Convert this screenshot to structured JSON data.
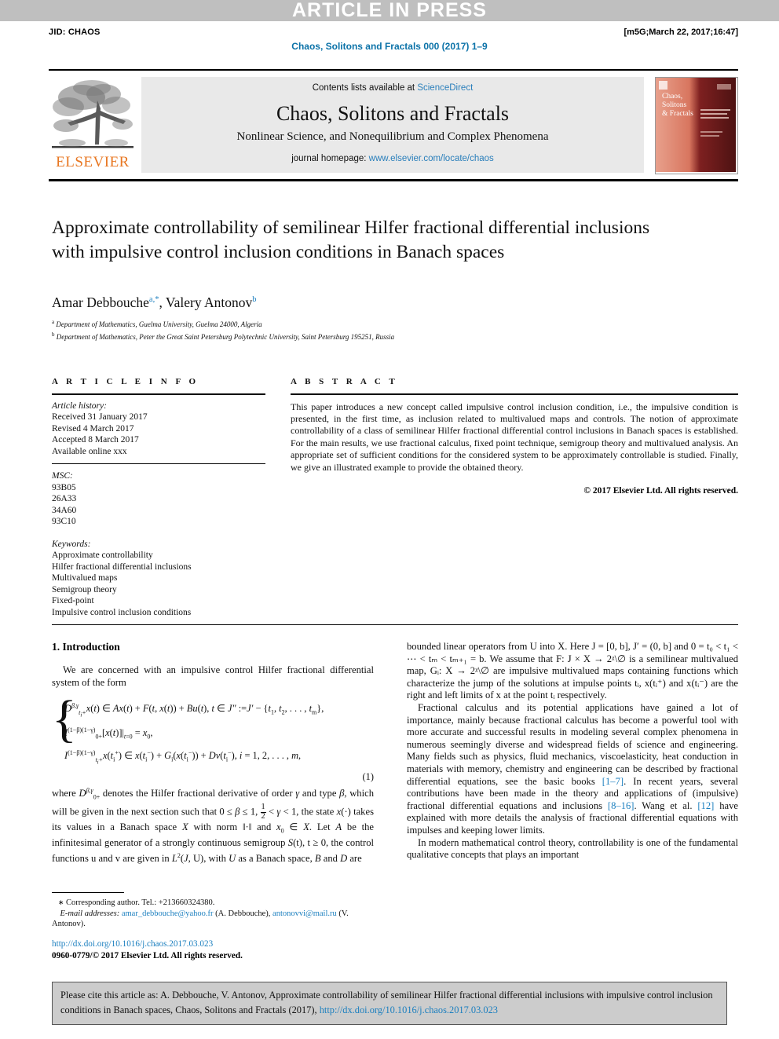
{
  "banner": {
    "text": "ARTICLE IN PRESS"
  },
  "runhead": {
    "jid": "JID: CHAOS",
    "stamp": "[m5G;March 22, 2017;16:47]",
    "journal_ref": "Chaos, Solitons and Fractals 000 (2017) 1–9"
  },
  "masthead": {
    "publisher": "ELSEVIER",
    "contents_prefix": "Contents lists available at ",
    "contents_link": "ScienceDirect",
    "journal_name": "Chaos, Solitons and Fractals",
    "journal_subtitle": "Nonlinear Science, and Nonequilibrium and Complex Phenomena",
    "homepage_prefix": "journal homepage: ",
    "homepage_link": "www.elsevier.com/locate/chaos",
    "cover_title_line1": "Chaos,",
    "cover_title_line2": "Solitons",
    "cover_title_line3": "& Fractals"
  },
  "article": {
    "title": "Approximate controllability of semilinear Hilfer fractional differential inclusions with impulsive control inclusion conditions in Banach spaces",
    "author1": "Amar Debbouche",
    "author1_sup": "a,*",
    "author2": "Valery Antonov",
    "author2_sup": "b",
    "affiliation_a": "Department of Mathematics, Guelma University, Guelma 24000, Algeria",
    "affiliation_b": "Department of Mathematics, Peter the Great Saint Petersburg Polytechnic University, Saint Petersburg 195251, Russia"
  },
  "info": {
    "heading": "A R T I C L E    I N F O",
    "history_label": "Article history:",
    "history": [
      "Received 31 January 2017",
      "Revised 4 March 2017",
      "Accepted 8 March 2017",
      "Available online xxx"
    ],
    "msc_label": "MSC:",
    "msc": [
      "93B05",
      "26A33",
      "34A60",
      "93C10"
    ],
    "keywords_label": "Keywords:",
    "keywords": [
      "Approximate controllability",
      "Hilfer fractional differential inclusions",
      "Multivalued maps",
      "Semigroup theory",
      "Fixed-point",
      "Impulsive control inclusion conditions"
    ]
  },
  "abstract": {
    "heading": "A B S T R A C T",
    "text": "This paper introduces a new concept called impulsive control inclusion condition, i.e., the impulsive condition is presented, in the first time, as inclusion related to multivalued maps and controls. The notion of approximate controllability of a class of semilinear Hilfer fractional differential control inclusions in Banach spaces is established. For the main results, we use fractional calculus, fixed point technique, semigroup theory and multivalued analysis. An appropriate set of sufficient conditions for the considered system to be approximately controllable is studied. Finally, we give an illustrated example to provide the obtained theory.",
    "copyright": "© 2017 Elsevier Ltd. All rights reserved."
  },
  "body": {
    "section_title": "1. Introduction",
    "left_p1": "We are concerned with an impulsive control Hilfer fractional differential system of the form",
    "eq_number": "(1)",
    "left_p2_a": "where ",
    "left_p2_b": " denotes the Hilfer fractional derivative of order ",
    "left_p2_c": " and type ",
    "left_p2_d": ", which will be given in the next section such that 0 ≤ ",
    "left_p2_e": " ≤ 1, ",
    "left_p2_f": " < ",
    "left_p2_g": " < 1, the state ",
    "left_p2_h": "(·) takes its values in a Banach space ",
    "left_p2_i": " with norm ‖·‖ and ",
    "left_p2_j": " ∈ ",
    "left_p2_k": ". Let ",
    "left_p2_l": " be the infinitesimal generator of a strongly continuous semigroup ",
    "left_p2_m": "(t), t ≥ 0, the control functions u and v are given in ",
    "left_p2_n": ", U), with ",
    "left_p2_o": " as a Banach space, ",
    "left_p2_p": " and ",
    "left_p2_q": " are",
    "right_p1": "bounded linear operators from U into X. Here J = [0, b], J′ = (0, b] and 0 = t₀ < t₁ < ⋯ < tₘ < tₘ₊₁ = b. We assume that F: J × X → 2ᵡ\\∅ is a semilinear multivalued map, Gᵢ: X → 2ᵡ\\∅ are impulsive multivalued maps containing functions which characterize the jump of the solutions at impulse points tᵢ, x(tᵢ⁺) and x(tᵢ⁻) are the right and left limits of x at the point tᵢ respectively.",
    "right_p2_a": "Fractional calculus and its potential applications have gained a lot of importance, mainly because fractional calculus has become a powerful tool with more accurate and successful results in modeling several complex phenomena in numerous seemingly diverse and widespread fields of science and engineering. Many fields such as physics, fluid mechanics, viscoelasticity, heat conduction in materials with memory, chemistry and engineering can be described by fractional differential equations, see the basic books ",
    "right_p2_ref1": "[1–7]",
    "right_p2_b": ". In recent years, several contributions have been made in the theory and applications of (impulsive) fractional differential equations and inclusions ",
    "right_p2_ref2": "[8–16]",
    "right_p2_c": ". Wang et al. ",
    "right_p2_ref3": "[12]",
    "right_p2_d": " have explained with more details the analysis of fractional differential equations with impulses and keeping lower limits.",
    "right_p3": "In modern mathematical control theory, controllability is one of the fundamental qualitative concepts that plays an important"
  },
  "footnote": {
    "corresponding": "Corresponding author. Tel.: +213660324380.",
    "email_label": "E-mail addresses:",
    "email1": "amar_debbouche@yahoo.fr",
    "email1_owner": "(A. Debbouche),",
    "email2": "antonovvi@mail.ru",
    "email2_owner": "(V. Antonov).",
    "doi": "http://dx.doi.org/10.1016/j.chaos.2017.03.023",
    "issn_line": "0960-0779/© 2017 Elsevier Ltd. All rights reserved."
  },
  "citation": {
    "text": "Please cite this article as: A. Debbouche, V. Antonov, Approximate controllability of semilinear Hilfer fractional differential inclusions with impulsive control inclusion conditions in Banach spaces, Chaos, Solitons and Fractals (2017), ",
    "doi": "http://dx.doi.org/10.1016/j.chaos.2017.03.023"
  },
  "colors": {
    "link": "#1b7fbf",
    "banner_bg": "#bfbfbf",
    "elsevier_orange": "#e87722",
    "cite_bg": "#cccccc"
  }
}
